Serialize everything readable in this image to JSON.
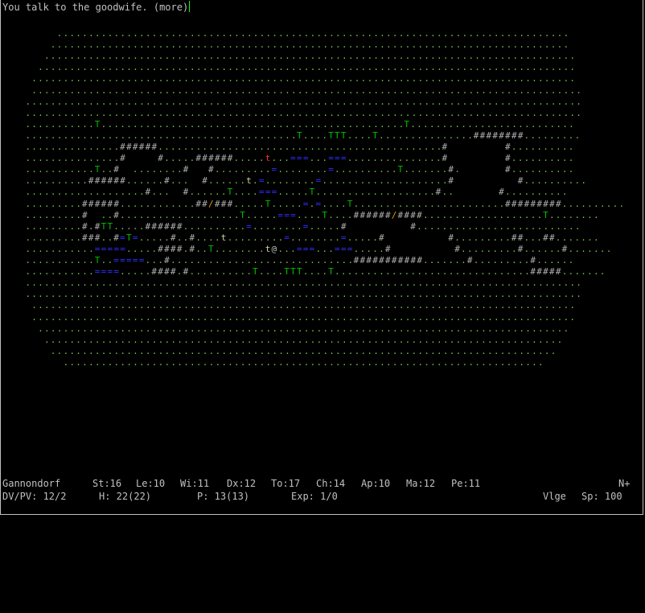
{
  "message": "You talk to the goodwife. (more)",
  "colors": {
    "background": "#000000",
    "text": "#c0c0c0",
    "grass": "#7ec850",
    "tree": "#00c000",
    "wall": "#b0b0b0",
    "water": "#3030ff",
    "door": "#d8a000",
    "townsfolk": "#d8d8a0",
    "goodwife": "#ff3030",
    "player": "#c0c0c0"
  },
  "map_rows": [
    "         .................................................................................",
    "        ..................................................................................",
    "       ....................................................................................",
    "      .....................................................................................",
    "     ......................................................................................",
    "     .......................................................................................",
    "    ........................................................................................",
    "    ........................................................................................",
    "    ...........T................................................T..........................",
    "    ...........................................T....TTT....T...............########.........",
    "    ...............######.............................................#         #..........",
    "    ...............#     #.....######.....t...===...===...............#         #..........",
    "    ...........T..#  ........#   #.........=........=..........T.......#.       #..........",
    "    ..........######......#...  #......t.=........=....................#          #..........",
    "    ...................#...  #......T....===.....T...................#..       #..........",
    "    .........######............##/###.....T.....=.=....T........................#########..........",
    "    .........#  ..#...................T.....===....T....######/####...................T........",
    "    .........#.#TT.....######..........=........=.....#          #..........................",
    "    .........###..#=T=.....#..#....t.........=........=.....#          #.........##...##.......",
    "    ...........=====.....####.#..T........t@...===...===.....#          #.........#......#.......",
    "    ...........T..=====...#.............................###########.......#.........#......",
    "    ...........====.....####.#..........T....TTT....T...............................#####.......",
    "    ........................................................................................",
    "    ........................................................................................",
    "     ......................................................................................",
    "     ......................................................................................",
    "      ....................................................................................",
    "       ..................................................................................",
    "        ................................................................................",
    "          ............................................................................"
  ],
  "status": {
    "name": "Gannondorf",
    "st": "St:16",
    "le": "Le:10",
    "wi": "Wi:11",
    "dx": "Dx:12",
    "to": "To:17",
    "ch": "Ch:14",
    "ap": "Ap:10",
    "ma": "Ma:12",
    "pe": "Pe:11",
    "level_indicator": "N+",
    "dvpv": "DV/PV: 12/2",
    "hp": "H: 22(22)",
    "pp": "P: 13(13)",
    "exp": "Exp: 1/0",
    "location": "Vlge",
    "speed": "Sp: 100"
  }
}
